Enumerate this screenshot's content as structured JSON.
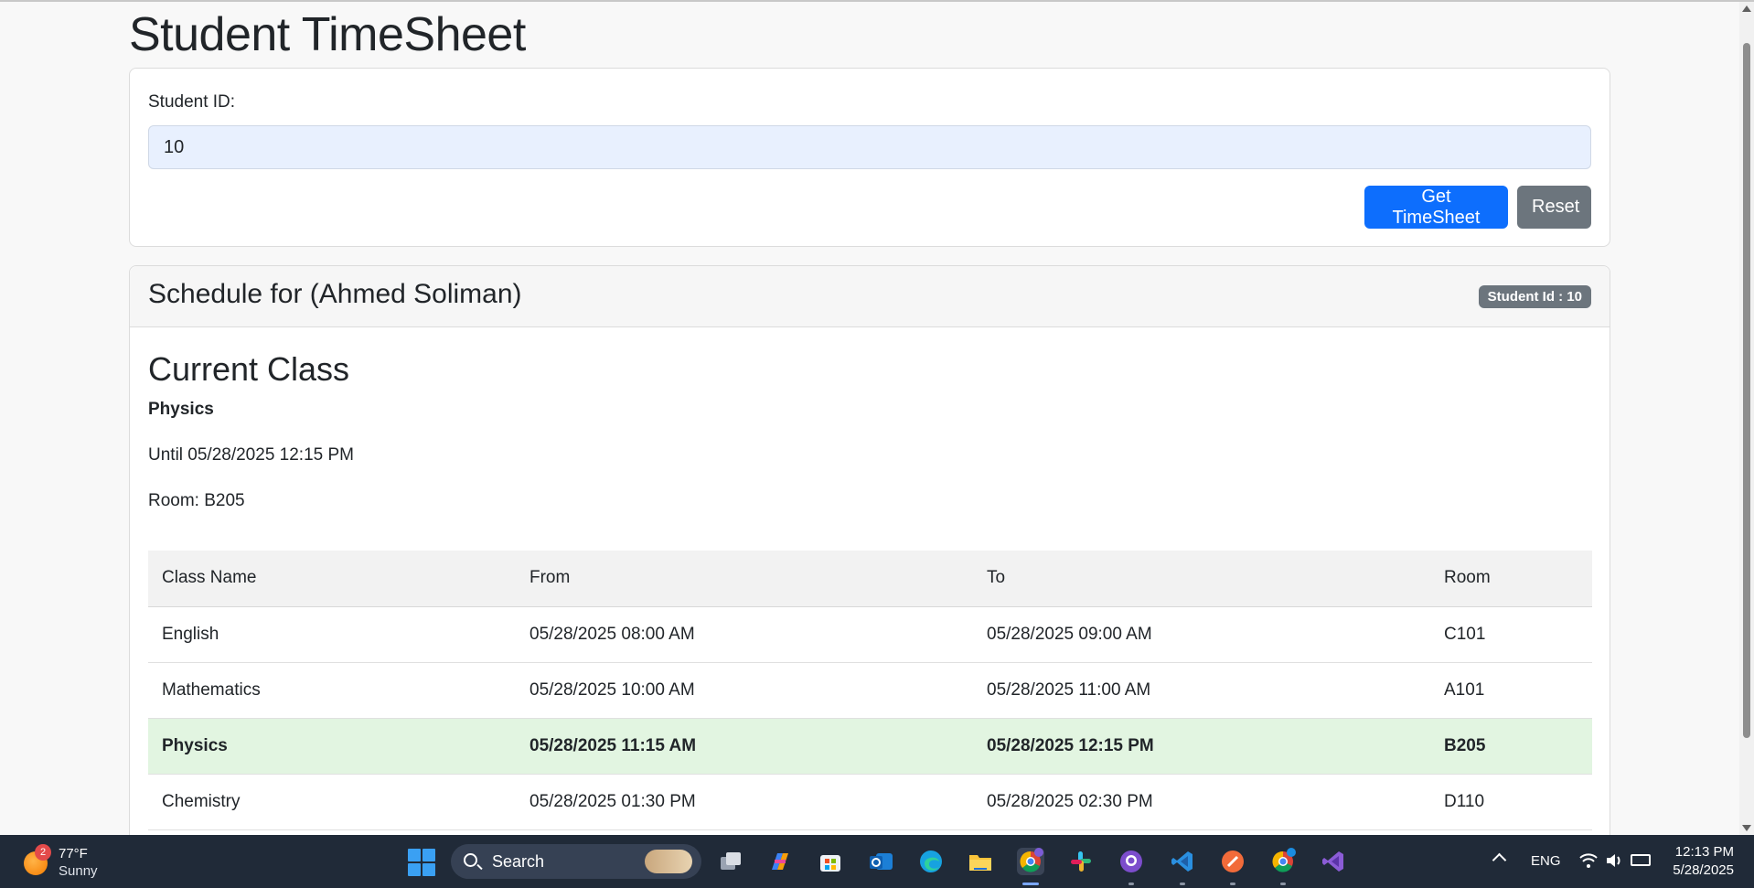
{
  "app": {
    "title": "Student TimeSheet"
  },
  "form": {
    "student_id_label": "Student ID:",
    "student_id_value": "10",
    "get_button": "Get TimeSheet",
    "reset_button": "Reset"
  },
  "schedule": {
    "header": "Schedule for (Ahmed Soliman)",
    "badge": "Student Id : 10",
    "current_heading": "Current Class",
    "current_class": "Physics",
    "current_until": "Until 05/28/2025 12:15 PM",
    "current_room": "Room: B205",
    "columns": [
      "Class Name",
      "From",
      "To",
      "Room"
    ],
    "rows": [
      {
        "name": "English",
        "from": "05/28/2025 08:00 AM",
        "to": "05/28/2025 09:00 AM",
        "room": "C101",
        "active": false
      },
      {
        "name": "Mathematics",
        "from": "05/28/2025 10:00 AM",
        "to": "05/28/2025 11:00 AM",
        "room": "A101",
        "active": false
      },
      {
        "name": "Physics",
        "from": "05/28/2025 11:15 AM",
        "to": "05/28/2025 12:15 PM",
        "room": "B205",
        "active": true
      },
      {
        "name": "Chemistry",
        "from": "05/28/2025 01:30 PM",
        "to": "05/28/2025 02:30 PM",
        "room": "D110",
        "active": false
      }
    ]
  },
  "taskbar": {
    "weather_badge": "2",
    "weather_temp": "77°F",
    "weather_condition": "Sunny",
    "search_label": "Search",
    "icons": [
      "task-view-icon",
      "copilot-icon",
      "store-icon",
      "outlook-icon",
      "edge-icon",
      "file-explorer-icon",
      "chrome-icon",
      "slack-icon",
      "github-desktop-icon",
      "vscode-icon",
      "postman-icon",
      "chrome-profile-icon",
      "visual-studio-icon"
    ],
    "language": "ENG",
    "time": "12:13 PM",
    "date": "5/28/2025"
  },
  "colors": {
    "primary": "#0d6efd",
    "secondary": "#6c757d",
    "active_row": "#e2f5e1",
    "input_bg": "#e8f0fe",
    "taskbar": "#202a38"
  }
}
